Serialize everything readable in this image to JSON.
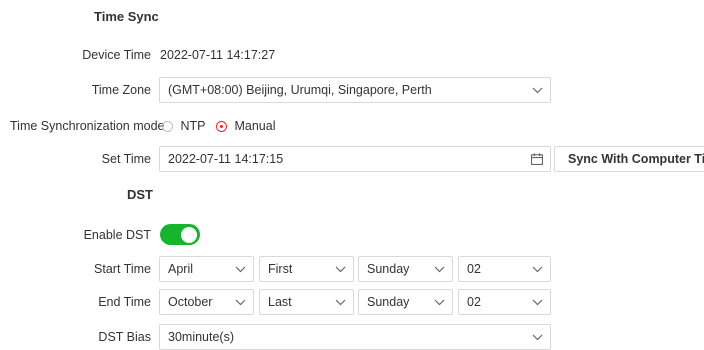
{
  "time_sync": {
    "title": "Time Sync",
    "device_time_label": "Device Time",
    "device_time_value": "2022-07-11 14:17:27",
    "time_zone_label": "Time Zone",
    "time_zone_value": "(GMT+08:00) Beijing, Urumqi, Singapore, Perth",
    "sync_mode_label": "Time Synchronization mode",
    "sync_mode_options": [
      {
        "label": "NTP",
        "selected": false
      },
      {
        "label": "Manual",
        "selected": true
      }
    ],
    "set_time_label": "Set Time",
    "set_time_value": "2022-07-11 14:17:15",
    "sync_button_label": "Sync With Computer Ti..."
  },
  "dst": {
    "title": "DST",
    "enable_label": "Enable DST",
    "enabled": true,
    "start_label": "Start Time",
    "start": {
      "month": "April",
      "week": "First",
      "day": "Sunday",
      "hour": "02"
    },
    "end_label": "End Time",
    "end": {
      "month": "October",
      "week": "Last",
      "day": "Sunday",
      "hour": "02"
    },
    "bias_label": "DST Bias",
    "bias_value": "30minute(s)"
  },
  "colors": {
    "toggle_on": "#18b42d",
    "radio_selected": "#e0272a"
  },
  "icons": {
    "dropdown": "chevron-down-icon",
    "calendar": "calendar-icon"
  }
}
